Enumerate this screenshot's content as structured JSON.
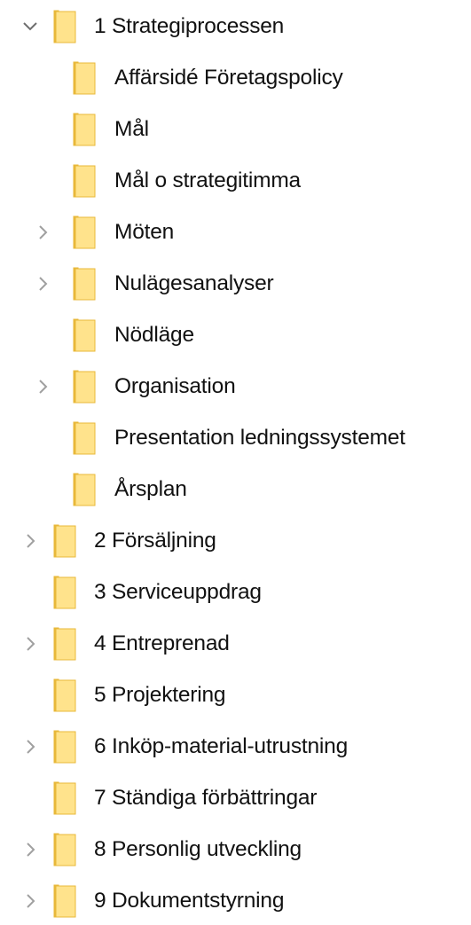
{
  "tree": {
    "items": [
      {
        "label": "1 Strategiprocessen",
        "level": 0,
        "chevron": "expanded"
      },
      {
        "label": "Affärsidé Företagspolicy",
        "level": 1,
        "chevron": "none"
      },
      {
        "label": "Mål",
        "level": 1,
        "chevron": "none"
      },
      {
        "label": "Mål o strategitimma",
        "level": 1,
        "chevron": "none"
      },
      {
        "label": "Möten",
        "level": 1,
        "chevron": "collapsed"
      },
      {
        "label": "Nulägesanalyser",
        "level": 1,
        "chevron": "collapsed"
      },
      {
        "label": "Nödläge",
        "level": 1,
        "chevron": "none"
      },
      {
        "label": "Organisation",
        "level": 1,
        "chevron": "collapsed"
      },
      {
        "label": "Presentation ledningssystemet",
        "level": 1,
        "chevron": "none"
      },
      {
        "label": "Årsplan",
        "level": 1,
        "chevron": "none"
      },
      {
        "label": "2 Försäljning",
        "level": 0,
        "chevron": "collapsed"
      },
      {
        "label": "3 Serviceuppdrag",
        "level": 0,
        "chevron": "none"
      },
      {
        "label": "4 Entreprenad",
        "level": 0,
        "chevron": "collapsed"
      },
      {
        "label": "5 Projektering",
        "level": 0,
        "chevron": "none"
      },
      {
        "label": "6 Inköp-material-utrustning",
        "level": 0,
        "chevron": "collapsed"
      },
      {
        "label": "7 Ständiga förbättringar",
        "level": 0,
        "chevron": "none"
      },
      {
        "label": "8 Personlig utveckling",
        "level": 0,
        "chevron": "collapsed"
      },
      {
        "label": "9 Dokumentstyrning",
        "level": 0,
        "chevron": "collapsed"
      }
    ]
  },
  "icons": {
    "folder": "folder-icon",
    "expanded": "chevron-down-icon",
    "collapsed": "chevron-right-icon"
  },
  "colors": {
    "folder_fill": "#FFE38C",
    "folder_edge": "#E8B83A",
    "chevron": "#6E6E6E",
    "text": "#111111",
    "background": "#FFFFFF"
  }
}
